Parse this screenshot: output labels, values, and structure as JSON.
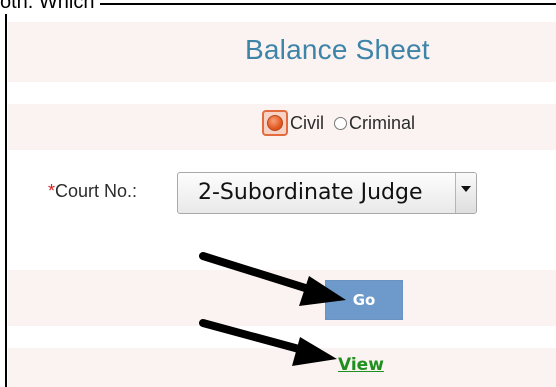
{
  "header": {
    "caption_fragment": "oth. Which"
  },
  "form": {
    "title": "Balance Sheet",
    "case_type": {
      "options": [
        "Civil",
        "Criminal"
      ],
      "selected": "Civil"
    },
    "court": {
      "required_marker": "*",
      "label": "Court No.:",
      "selected_value": "2-Subordinate Judge"
    },
    "go_button_label": "Go",
    "view_link_label": "View"
  },
  "annotations": {
    "arrow_color": "#000000",
    "arrows": [
      {
        "points_to": "go-button"
      },
      {
        "points_to": "view-link"
      }
    ]
  },
  "colors": {
    "title": "#3d84a8",
    "row_background": "#fbf3f1",
    "go_button": "#6e9acb",
    "view_link": "#1f8f1f",
    "required": "#d62020",
    "radio_selected": "#e35a22"
  }
}
